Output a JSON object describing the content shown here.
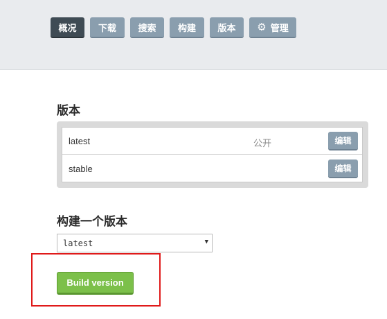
{
  "nav": {
    "tabs": [
      {
        "label": "概况",
        "active": true
      },
      {
        "label": "下载",
        "active": false
      },
      {
        "label": "搜索",
        "active": false
      },
      {
        "label": "构建",
        "active": false
      },
      {
        "label": "版本",
        "active": false
      },
      {
        "label": "管理",
        "active": false,
        "icon": "gear-icon"
      }
    ]
  },
  "versions": {
    "title": "版本",
    "rows": [
      {
        "name": "latest",
        "privacy": "公开",
        "edit_label": "编辑"
      },
      {
        "name": "stable",
        "privacy": "",
        "edit_label": "编辑"
      }
    ]
  },
  "build": {
    "title": "构建一个版本",
    "select_value": "latest",
    "button_label": "Build version"
  },
  "colors": {
    "accent_green": "#7cc04a",
    "nav_active": "#3f4b54",
    "nav_inactive": "#8a9eae",
    "highlight": "#e01a1a"
  }
}
